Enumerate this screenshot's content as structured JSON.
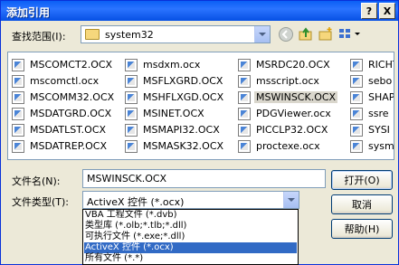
{
  "window": {
    "title": "添加引用",
    "help_btn": "?",
    "close_btn": "X"
  },
  "lookin": {
    "label": "查找范围(I):",
    "value": "system32"
  },
  "files": [
    "MSCOMCT2.OCX",
    "mscomctl.ocx",
    "MSCOMM32.OCX",
    "MSDATGRD.OCX",
    "MSDATLST.OCX",
    "MSDATREP.OCX",
    "msdxm.ocx",
    "MSFLXGRD.OCX",
    "MSHFLXGD.OCX",
    "MSINET.OCX",
    "MSMAPI32.OCX",
    "MSMASK32.OCX",
    "MSRDC20.OCX",
    "msscript.ocx",
    "MSWINSCK.OCX",
    "PDGViewer.ocx",
    "PICCLP32.OCX",
    "proctexe.ocx",
    "RICHT",
    "sebo",
    "SHAP",
    "ssre",
    "SYSI",
    "sysm"
  ],
  "selected_file": "MSWINSCK.OCX",
  "filename": {
    "label": "文件名(N):",
    "value": "MSWINSCK.OCX"
  },
  "filetype": {
    "label": "文件类型(T):",
    "value": "ActiveX 控件 (*.ocx)",
    "options": [
      "VBA 工程文件 (*.dvb)",
      "类型库 (*.olb;*.tlb;*.dll)",
      "可执行文件 (*.exe;*.dll)",
      "ActiveX 控件 (*.ocx)",
      "所有文件 (*.*)"
    ],
    "selected_index": 3
  },
  "buttons": {
    "open": "打开(O)",
    "cancel": "取消",
    "help": "帮助(H)"
  }
}
